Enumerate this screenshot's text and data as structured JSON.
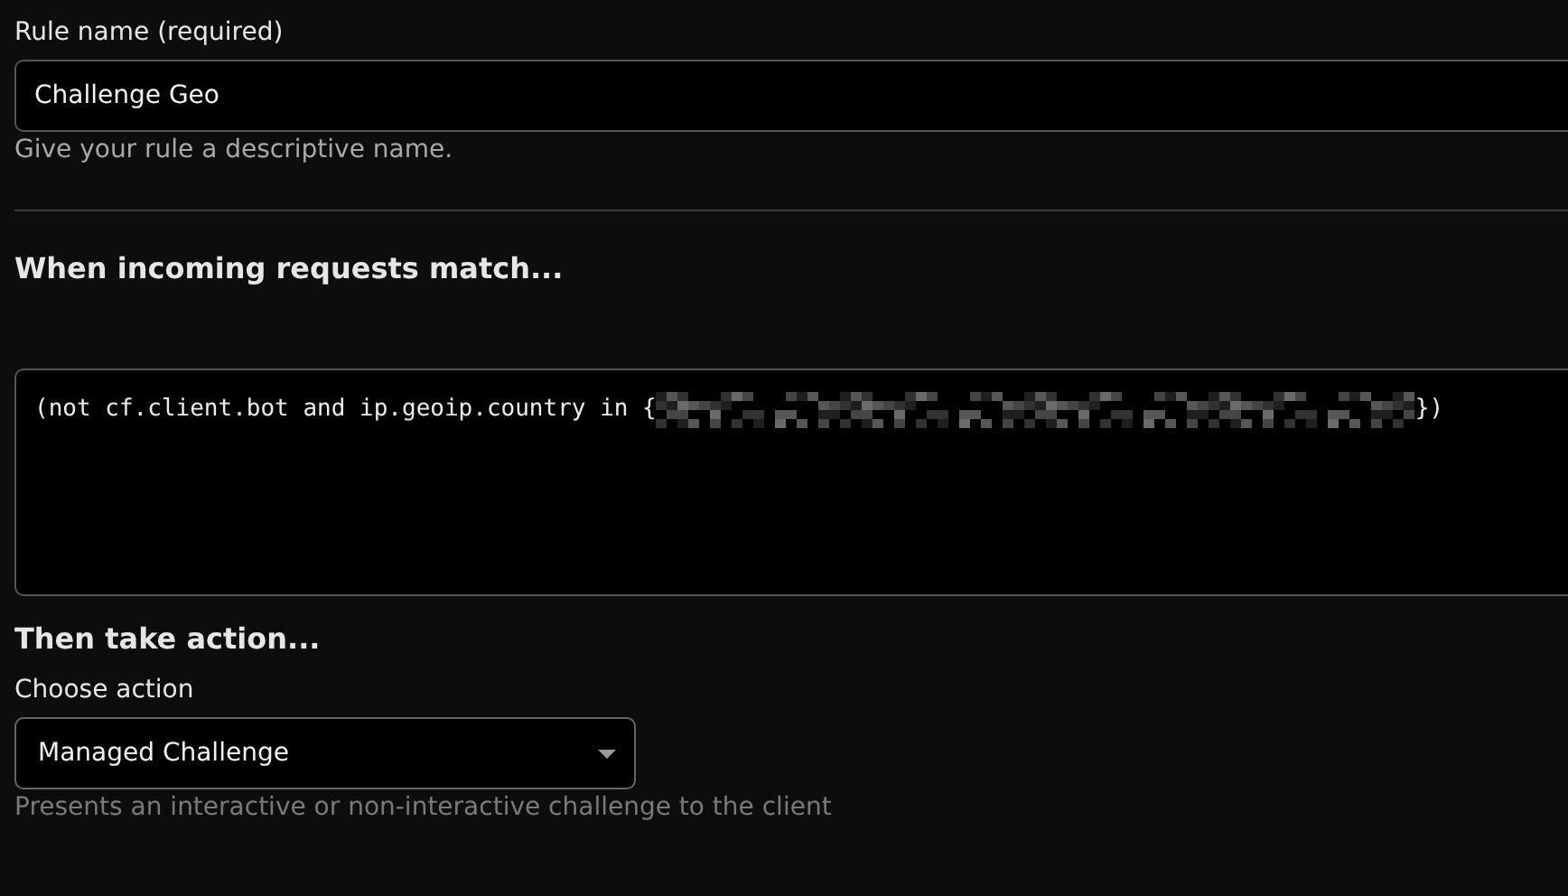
{
  "rule_name": {
    "label": "Rule name (required)",
    "value": "Challenge Geo",
    "hint": "Give your rule a descriptive name."
  },
  "match": {
    "heading": "When incoming requests match...",
    "expression_start": "(not cf.client.bot and ip.geoip.country in {",
    "redacted": true,
    "expression_end": "})"
  },
  "action": {
    "heading": "Then take action...",
    "label": "Choose action",
    "value": "Managed Challenge",
    "hint": "Presents an interactive or non-interactive challenge to the client"
  }
}
